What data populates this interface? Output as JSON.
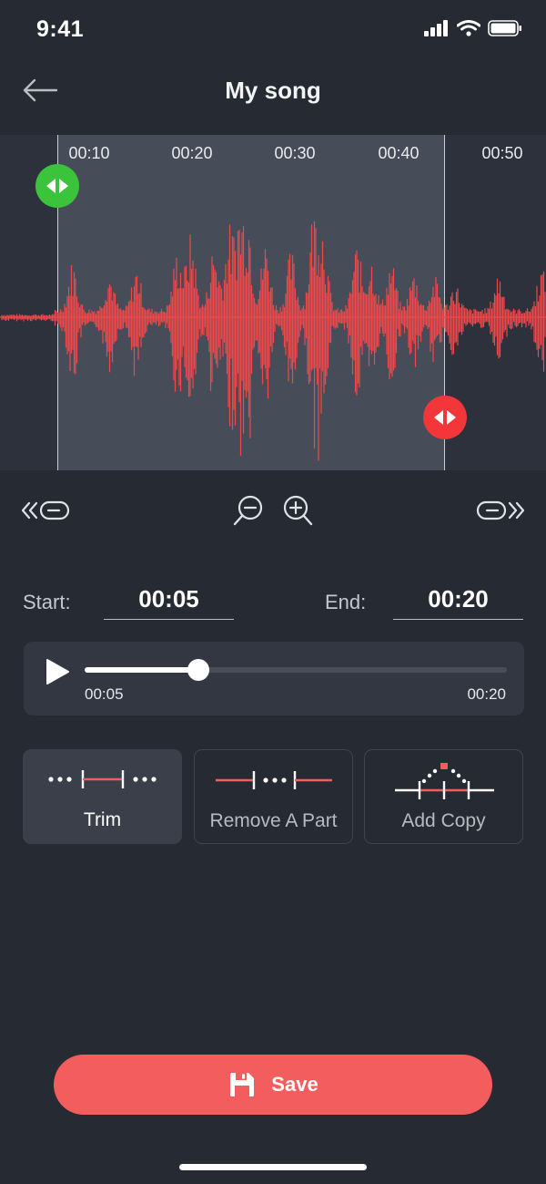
{
  "status_bar": {
    "time": "9:41",
    "icons": [
      "signal-icon",
      "wifi-icon",
      "battery-icon"
    ]
  },
  "nav": {
    "title": "My song",
    "back_icon": "arrow-left-icon"
  },
  "timeline": {
    "ticks": [
      {
        "label": "00:10",
        "seconds": 10
      },
      {
        "label": "00:20",
        "seconds": 20
      },
      {
        "label": "00:30",
        "seconds": 30
      },
      {
        "label": "00:40",
        "seconds": 40
      },
      {
        "label": "00:50",
        "seconds": 50
      }
    ]
  },
  "toolbar": {
    "icons": [
      "jump-start-icon",
      "zoom-out-icon",
      "zoom-in-icon",
      "jump-end-icon"
    ]
  },
  "range": {
    "start_label": "Start:",
    "start_value": "00:05",
    "end_label": "End:",
    "end_value": "00:20"
  },
  "player": {
    "current": "00:05",
    "end": "00:20",
    "progress": 0.27
  },
  "tools": [
    {
      "label": "Trim",
      "icon": "trim-icon",
      "active": true
    },
    {
      "label": "Remove A Part",
      "icon": "remove-part-icon",
      "active": false
    },
    {
      "label": "Add Copy",
      "icon": "add-copy-icon",
      "active": false
    }
  ],
  "save": {
    "label": "Save",
    "icon": "save-icon"
  },
  "colors": {
    "background": "#262a33",
    "waveform": "#f0484a",
    "accent": "#f45d5d",
    "start_handle": "#3cc33c",
    "end_handle": "#f2363a"
  }
}
